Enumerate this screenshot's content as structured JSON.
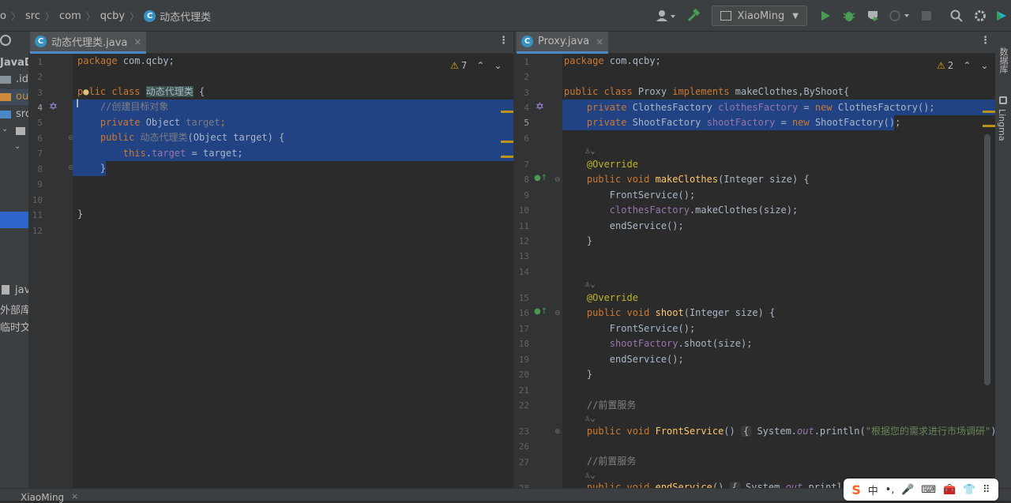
{
  "breadcrumb": {
    "items": [
      "o",
      "src",
      "com",
      "qcby"
    ],
    "class_badge": "C",
    "current": "动态代理类"
  },
  "toolbar": {
    "run_config": "XiaoMing",
    "icons": [
      "user-icon",
      "hammer-icon",
      "run-icon",
      "debug-icon",
      "coverage-icon",
      "profile-icon",
      "stop-icon",
      "search-icon",
      "gear-icon",
      "logo-icon"
    ]
  },
  "left_tool": {
    "items": [
      "JavaD",
      ".id",
      "ou",
      "src",
      "jav",
      "外部库",
      "临时文"
    ]
  },
  "left_editor": {
    "tab": {
      "badge": "C",
      "name": "动态代理类.java",
      "close": "×"
    },
    "warnings": "7",
    "line_numbers": [
      "1",
      "2",
      "3",
      "4",
      "5",
      "6",
      "7",
      "8",
      "9",
      "10",
      "11",
      "12"
    ],
    "lines": {
      "l1_kw": "package",
      "l1_rest": " com.qcby;",
      "l3_a": "p",
      "l3_b": "lic",
      "l3_kw2": " class ",
      "l3_cls": "动态代理类",
      "l3_end": " {",
      "l4_cmt": "    //创建目标对象",
      "l5_kw": "    private",
      "l5_type": " Object ",
      "l5_fld": "target",
      "l5_end": ";",
      "l6_kw": "    public",
      "l6_sp": " ",
      "l6_ctor": "动态代理类",
      "l6_args": "(Object target) {",
      "l7_kw": "        this",
      "l7_dot": ".",
      "l7_fld": "target",
      "l7_end": " = target;",
      "l8": "    }",
      "l11": "}"
    }
  },
  "right_editor": {
    "tab": {
      "badge": "C",
      "name": "Proxy.java",
      "close": "×"
    },
    "warnings": "2",
    "line_numbers": [
      "1",
      "2",
      "3",
      "4",
      "5",
      "6",
      "",
      "7",
      "8",
      "9",
      "10",
      "11",
      "12",
      "13",
      "14",
      "",
      "15",
      "16",
      "17",
      "18",
      "19",
      "20",
      "21",
      "22",
      "",
      "23",
      "26",
      "27",
      "",
      "28"
    ],
    "lines": {
      "r1_kw": "package",
      "r1_rest": " com.qcby;",
      "r3_kw": "public class",
      "r3_cls": " Proxy ",
      "r3_kw2": "implements",
      "r3_rest": " makeClothes,ByShoot{",
      "r4_kw": "    private",
      "r4_type": " ClothesFactory ",
      "r4_fld": "clothesFactory",
      "r4_eq": " = ",
      "r4_new": "new",
      "r4_end": " ClothesFactory();",
      "r5_kw": "    private",
      "r5_type": " ShootFactory ",
      "r5_fld": "shootFactory",
      "r5_eq": " = ",
      "r5_new": "new",
      "r5_end": " ShootFactory();",
      "hint": "    ♙⌄",
      "r7_ann": "    @Override",
      "r8_kw": "    public void ",
      "r8_fn": "makeClothes",
      "r8_rest": "(Integer size) {",
      "r9": "        FrontService();",
      "r10_fld": "        clothesFactory",
      "r10_rest": ".makeClothes(size);",
      "r11": "        endService();",
      "r12": "    }",
      "r15_ann": "    @Override",
      "r16_kw": "    public void ",
      "r16_fn": "shoot",
      "r16_rest": "(Integer size) {",
      "r17": "        FrontService();",
      "r18_fld": "        shootFactory",
      "r18_rest": ".shoot(size);",
      "r19": "        endService();",
      "r20": "    }",
      "r22_cmt": "    //前置服务",
      "r23_kw": "    public void ",
      "r23_fn": "FrontService",
      "r23_p": "() ",
      "r23_b1": "{",
      "r23_a": " System.",
      "r23_out": "out",
      "r23_b": ".println(",
      "r23_str": "\"根据您的需求进行市场调研\"",
      "r23_c": "); ",
      "r23_b2": "}",
      "r27_cmt": "    //前置服务",
      "r28_kw": "    public void ",
      "r28_fn": "endService",
      "r28_p": "() ",
      "r28_b1": "{",
      "r28_a": " System.",
      "r28_out": "out",
      "r28_b": ".println("
    }
  },
  "right_strip": {
    "db": "数据库",
    "lingma": "Lingma"
  },
  "bottom": {
    "label": "XiaoMing",
    "close": "×"
  },
  "ime": {
    "logo": "S",
    "items": [
      "中",
      "•,",
      "🎤",
      "⌨",
      "🧰",
      "👕",
      "⠿"
    ]
  }
}
